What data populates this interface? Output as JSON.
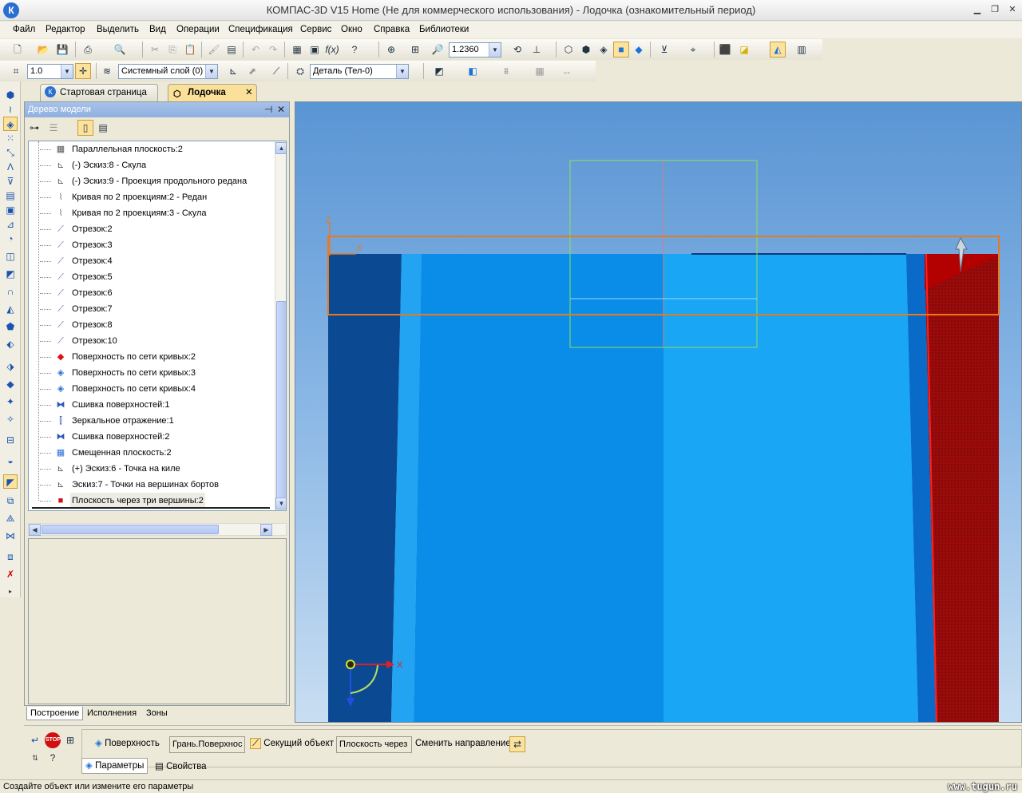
{
  "app": {
    "title": "КОМПАС-3D V15 Home (Не для коммерческого использования) - Лодочка (ознакомительный период)",
    "logo": "К"
  },
  "menu": [
    "Файл",
    "Редактор",
    "Выделить",
    "Вид",
    "Операции",
    "Спецификация",
    "Сервис",
    "Окно",
    "Справка",
    "Библиотеки"
  ],
  "toolbar": {
    "zoom_value": "1.2360",
    "step_value": "1.0",
    "layer_value": "Системный слой (0)",
    "detail_value": "Деталь (Тел-0)"
  },
  "doc_tabs": [
    {
      "label": "Стартовая страница",
      "active": false
    },
    {
      "label": "Лодочка",
      "active": true
    }
  ],
  "tree": {
    "header": "Дерево модели",
    "items": [
      {
        "icon": "plane",
        "label": "Параллельная плоскость:2"
      },
      {
        "icon": "sketch",
        "label": "(-) Эскиз:8 - Скула"
      },
      {
        "icon": "sketch",
        "label": "(-) Эскиз:9 - Проекция продольного редана"
      },
      {
        "icon": "curve",
        "label": "Кривая по 2 проекциям:2 - Редан"
      },
      {
        "icon": "curve",
        "label": "Кривая по 2 проекциям:3 - Скула"
      },
      {
        "icon": "segment",
        "label": "Отрезок:2"
      },
      {
        "icon": "segment",
        "label": "Отрезок:3"
      },
      {
        "icon": "segment",
        "label": "Отрезок:4"
      },
      {
        "icon": "segment",
        "label": "Отрезок:5"
      },
      {
        "icon": "segment",
        "label": "Отрезок:6"
      },
      {
        "icon": "segment",
        "label": "Отрезок:7"
      },
      {
        "icon": "segment",
        "label": "Отрезок:8"
      },
      {
        "icon": "segment",
        "label": "Отрезок:10"
      },
      {
        "icon": "surface-red",
        "label": "Поверхность по сети кривых:2"
      },
      {
        "icon": "surface",
        "label": "Поверхность по сети кривых:3"
      },
      {
        "icon": "surface",
        "label": "Поверхность по сети кривых:4"
      },
      {
        "icon": "stitch",
        "label": "Сшивка поверхностей:1"
      },
      {
        "icon": "mirror",
        "label": "Зеркальное отражение:1"
      },
      {
        "icon": "stitch",
        "label": "Сшивка поверхностей:2"
      },
      {
        "icon": "offset-plane",
        "label": "Смещенная плоскость:2"
      },
      {
        "icon": "sketch",
        "label": "(+) Эскиз:6 - Точка на киле"
      },
      {
        "icon": "sketch",
        "label": "Эскиз:7 - Точки на вершинах бортов"
      },
      {
        "icon": "plane-red",
        "label": "Плоскость через три вершины:2"
      }
    ],
    "pane_tabs": [
      "Построение",
      "Исполнения",
      "Зоны"
    ]
  },
  "viewport": {
    "axis_z": "Z",
    "axis_x": "X",
    "triad_x": "X"
  },
  "properties": {
    "surface_label": "Поверхность",
    "surface_value": "Грань.Поверхнос",
    "section_label": "Секущий объект",
    "section_value": "Плоскость через",
    "direction_label": "Сменить направление",
    "tabs": [
      "Параметры",
      "Свойства"
    ]
  },
  "status": {
    "message": "Создайте объект или измените его параметры",
    "watermark": "www.tugun.ru"
  },
  "colors": {
    "accent": "#fde29b",
    "surface_blue": "#0a8de8",
    "surface_red": "#9a0b0b",
    "selection_orange": "#e87a1e"
  }
}
